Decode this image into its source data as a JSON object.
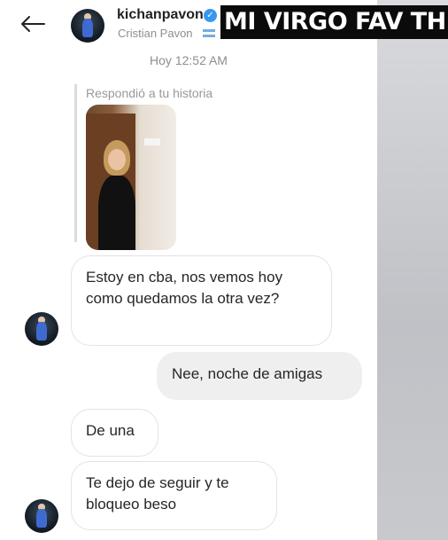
{
  "overlay": {
    "caption": "MI VIRGO FAV THIS IS"
  },
  "header": {
    "username": "kichanpavon",
    "full_name": "Cristian Pavon",
    "icons": [
      "back-arrow-icon",
      "verified-badge-icon",
      "argentina-flag-icon"
    ]
  },
  "thread": {
    "timestamp": "Hoy 12:52 AM",
    "story_reply_label": "Respondió a tu historia",
    "messages": [
      {
        "from": "them",
        "text": "Estoy en cba, nos vemos hoy como quedamos la otra vez?"
      },
      {
        "from": "me",
        "text": "Nee, noche de amigas"
      },
      {
        "from": "them",
        "text": "De una"
      },
      {
        "from": "them",
        "text": "Te dejo de seguir y te bloqueo beso"
      }
    ]
  },
  "colors": {
    "verified": "#3897f0",
    "my_bubble": "#efefef",
    "caption_bg": "#0b0b0b"
  }
}
